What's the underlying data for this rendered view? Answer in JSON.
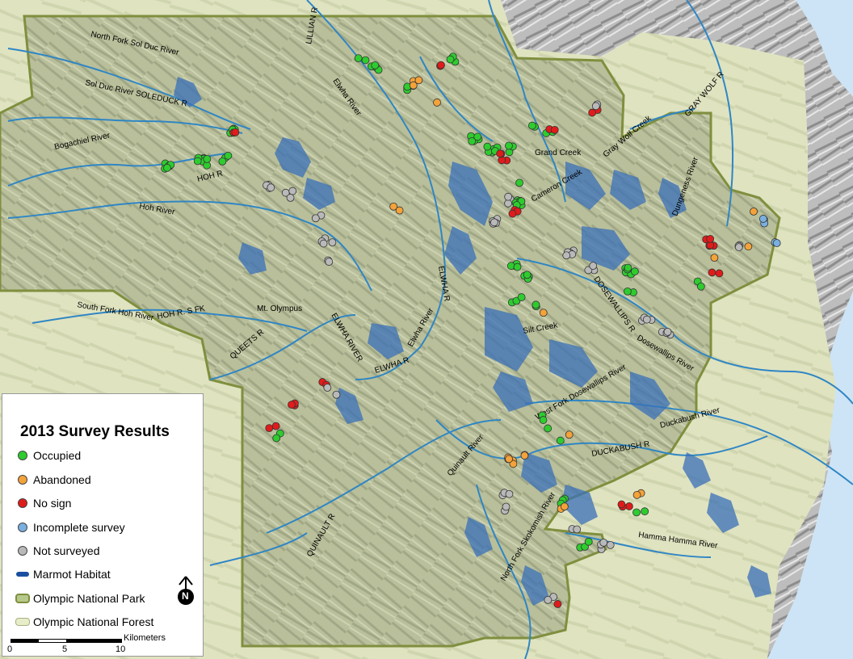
{
  "legend": {
    "title": "2013 Survey Results",
    "items": [
      {
        "label": "Occupied",
        "color": "#2ecc2e",
        "symbol": "dot"
      },
      {
        "label": "Abandoned",
        "color": "#f4a23a",
        "symbol": "dot"
      },
      {
        "label": "No sign",
        "color": "#e01b1b",
        "symbol": "dot"
      },
      {
        "label": "Incomplete survey",
        "color": "#7ab0e0",
        "symbol": "dot"
      },
      {
        "label": "Not surveyed",
        "color": "#b9b9b9",
        "symbol": "dot"
      },
      {
        "label": "Marmot Habitat",
        "color": "#1a4fa0",
        "symbol": "bar"
      },
      {
        "label": "Olympic National Park",
        "color": "#b7c98a",
        "symbol": "outline"
      },
      {
        "label": "Olympic National Forest",
        "color": "#e7ecc9",
        "symbol": "fill"
      }
    ],
    "scale": {
      "ticks": [
        "0",
        "5",
        "10"
      ],
      "unit": "Kilometers"
    },
    "north_letter": "N"
  },
  "labels": {
    "nf_sol_duc": "North Fork Sol Duc River",
    "sol_duc": "Sol Duc River SOLEDUCK R",
    "bogachiel": "Bogachiel River",
    "hoh_river": "Hoh River",
    "hoh_r": "HOH R",
    "sf_hoh": "South Fork Hoh River",
    "hoh_sfk": "HOH R. S FK",
    "mt_olympus": "Mt. Olympus",
    "queets": "QUEETS R",
    "elwha_river_w": "ELWHA RIVER",
    "elwha_r": "ELWHA R",
    "elwha_river_lower": "Elwha River",
    "elwha_r_vert": "ELWHA R",
    "elwha_river_n": "Elwha River",
    "lillian": "LILLIAN R",
    "grand_creek": "Grand Creek",
    "cameron_creek": "Cameron Creek",
    "gray_wolf_creek": "Gray Wolf Creek",
    "gray_wolf": "GRAY WOLF R",
    "dungeness": "Dungeness River",
    "dosewallips_r": "DOSEWALLIPS R",
    "silt_creek": "Silt Creek",
    "dosewallips_river": "Dosewallips River",
    "wf_dosewallips": "West Fork Dosewallips River",
    "duckabush_r": "DUCKABUSH R",
    "duckabush_river": "Duckabush River",
    "quinault_river": "Quinault River",
    "quinault_r": "QUINAULT R",
    "nf_skokomish": "North Fork Skokomish River",
    "hamma_hamma": "Hamma Hamma River"
  }
}
